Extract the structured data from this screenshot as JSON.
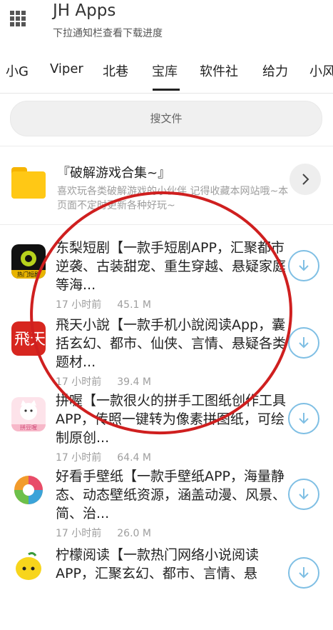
{
  "header": {
    "title": "JH Apps",
    "subtitle": "下拉通知栏查看下载进度",
    "menu_icon": "grid-menu-icon"
  },
  "tabs": [
    {
      "label": "小G",
      "active": false
    },
    {
      "label": "Viper",
      "active": false
    },
    {
      "label": "北巷",
      "active": false
    },
    {
      "label": "宝库",
      "active": true
    },
    {
      "label": "软件社",
      "active": false
    },
    {
      "label": "给力",
      "active": false
    },
    {
      "label": "小风",
      "active": false
    }
  ],
  "search": {
    "placeholder": "搜文件"
  },
  "collection": {
    "title": "『破解游戏合集~』",
    "description": "喜欢玩各类破解游戏的小伙伴 记得收藏本网站哦~本页面不定时更新各种好玩~",
    "icon": "folder-icon"
  },
  "items": [
    {
      "title": "东梨短剧【一款手短剧APP，汇聚都市逆袭、古装甜宠、重生穿越、悬疑家庭等海...",
      "time": "17 小时前",
      "size": "45.1 M",
      "icon_text": "热门短剧"
    },
    {
      "title": "飛天小說【一款手机小說阅读App，囊括玄幻、都市、仙侠、言情、悬疑各类题材...",
      "time": "17 小时前",
      "size": "39.4 M",
      "icon_text": "飛天"
    },
    {
      "title": "拼喔【一款很火的拼手工图纸创作工具APP，传照一键转为像素拼图纸，可绘制原创...",
      "time": "17 小时前",
      "size": "64.4 M",
      "icon_text": "拼豆喔"
    },
    {
      "title": "好看手壁纸【一款手壁纸APP，海量静态、动态壁纸资源，涵盖动漫、风景、简、治...",
      "time": "17 小时前",
      "size": "26.0 M",
      "icon_text": ""
    },
    {
      "title": "柠檬阅读【一款热门网络小说阅读APP，汇聚玄幻、都市、言情、悬",
      "time": "",
      "size": "",
      "icon_text": ""
    }
  ],
  "colors": {
    "accent_blue": "#7fbfe4",
    "annotation_red": "#cf1f1f",
    "folder_yellow": "#ffc815"
  }
}
